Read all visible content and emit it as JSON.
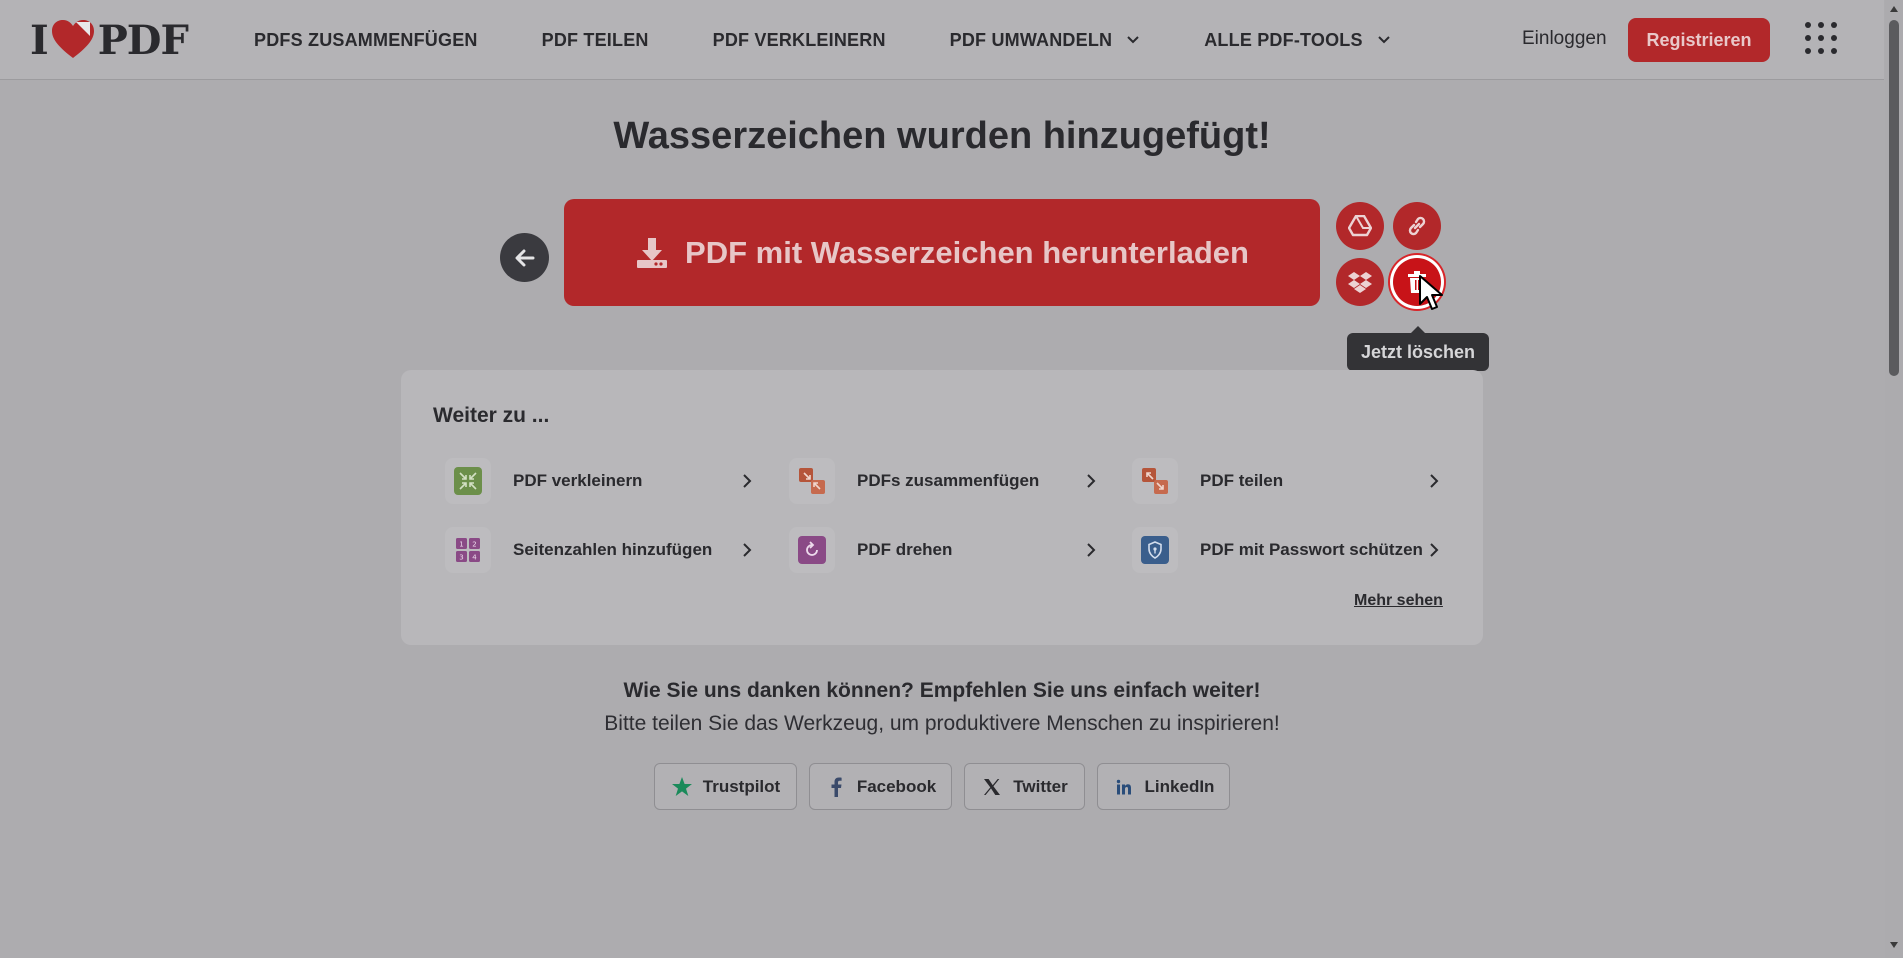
{
  "header": {
    "logo_left": "I",
    "logo_right": "PDF",
    "nav": [
      {
        "label": "PDFS ZUSAMMENFÜGEN",
        "dropdown": false
      },
      {
        "label": "PDF TEILEN",
        "dropdown": false
      },
      {
        "label": "PDF VERKLEINERN",
        "dropdown": false
      },
      {
        "label": "PDF UMWANDELN",
        "dropdown": true
      },
      {
        "label": "ALLE PDF-TOOLS",
        "dropdown": true
      }
    ],
    "login": "Einloggen",
    "register": "Registrieren"
  },
  "main": {
    "title": "Wasserzeichen wurden hinzugefügt!",
    "download_label": "PDF mit Wasserzeichen herunterladen",
    "tooltip": "Jetzt löschen"
  },
  "continue": {
    "title": "Weiter zu ...",
    "tools": [
      {
        "label": "PDF verkleinern",
        "icon": "compress-icon",
        "color": "#6c8f4a"
      },
      {
        "label": "PDFs zusammenfügen",
        "icon": "merge-icon",
        "color": "#b5553a"
      },
      {
        "label": "PDF teilen",
        "icon": "split-icon",
        "color": "#b5553a"
      },
      {
        "label": "Seitenzahlen hinzufügen",
        "icon": "page-numbers-icon",
        "color": "#8a4a86"
      },
      {
        "label": "PDF drehen",
        "icon": "rotate-icon",
        "color": "#8a4a86"
      },
      {
        "label": "PDF mit Passwort schützen",
        "icon": "shield-icon",
        "color": "#3a5e8c"
      }
    ],
    "more": "Mehr sehen"
  },
  "share": {
    "title": "Wie Sie uns danken können? Empfehlen Sie uns einfach weiter!",
    "subtitle": "Bitte teilen Sie das Werkzeug, um produktivere Menschen zu inspirieren!",
    "buttons": [
      {
        "label": "Trustpilot"
      },
      {
        "label": "Facebook"
      },
      {
        "label": "Twitter"
      },
      {
        "label": "LinkedIn"
      }
    ]
  },
  "colors": {
    "accent": "#b2282a",
    "background": "#adacaf"
  }
}
